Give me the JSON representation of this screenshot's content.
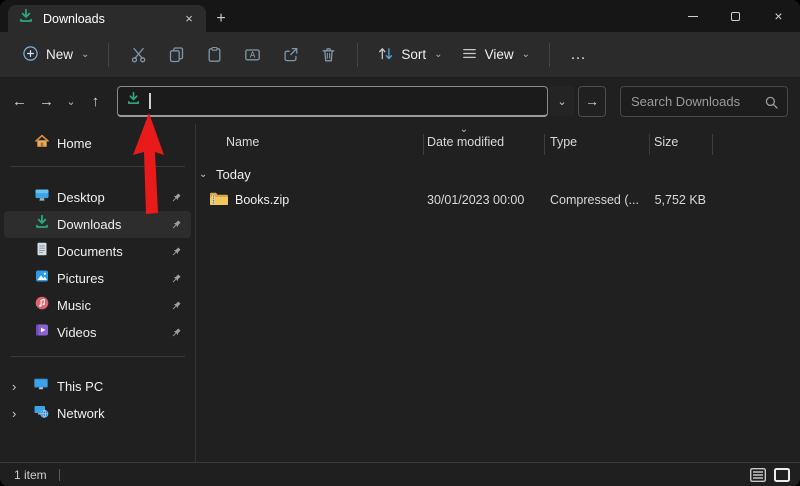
{
  "glyphs": {
    "chevron_down": "⌄",
    "chevron_right": "›",
    "back": "←",
    "forward": "→",
    "up": "↑",
    "go": "→",
    "more": "…",
    "plus": "+",
    "close": "×"
  },
  "titlebar": {
    "tab_label": "Downloads"
  },
  "toolbar": {
    "new_label": "New",
    "sort_label": "Sort",
    "view_label": "View"
  },
  "navigation": {
    "address_value": "",
    "search_placeholder": "Search Downloads"
  },
  "sidebar": {
    "home": {
      "label": "Home"
    },
    "pinned": [
      {
        "label": "Desktop"
      },
      {
        "label": "Downloads"
      },
      {
        "label": "Documents"
      },
      {
        "label": "Pictures"
      },
      {
        "label": "Music"
      },
      {
        "label": "Videos"
      }
    ],
    "tree": [
      {
        "label": "This PC"
      },
      {
        "label": "Network"
      }
    ]
  },
  "files": {
    "columns": [
      {
        "label": "Name"
      },
      {
        "label": "Date modified"
      },
      {
        "label": "Type"
      },
      {
        "label": "Size"
      }
    ],
    "group_label": "Today",
    "rows": [
      {
        "name": "Books.zip",
        "date_modified": "30/01/2023 00:00",
        "type": "Compressed (...",
        "size": "5,752 KB"
      }
    ]
  },
  "statusbar": {
    "item_count": "1 item"
  },
  "colors": {
    "accent_green": "#2aa97a",
    "arrow_red": "#e81a1a"
  }
}
